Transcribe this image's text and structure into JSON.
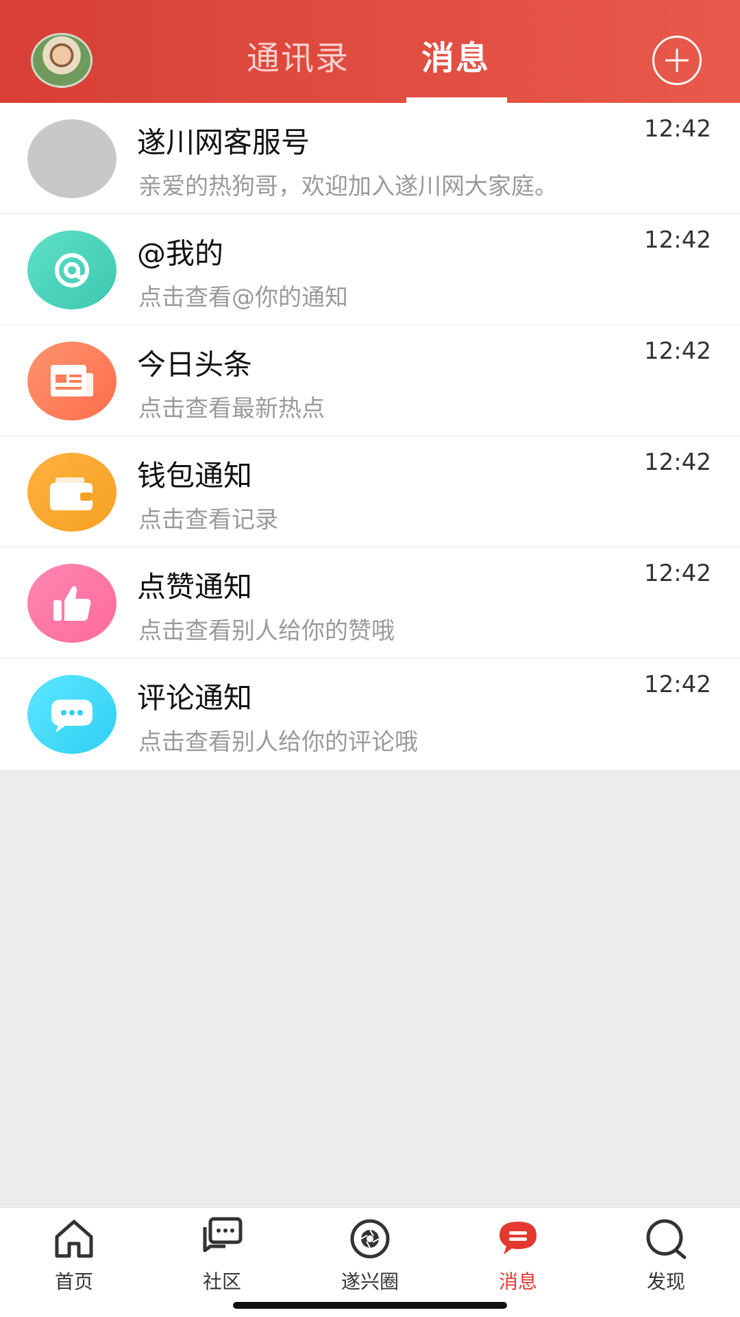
{
  "header": {
    "tabs": [
      {
        "label": "通讯录"
      },
      {
        "label": "消息",
        "active": true
      }
    ],
    "add_icon": "plus-circle-icon"
  },
  "messages": [
    {
      "title": "遂川网客服号",
      "subtitle": "亲爱的热狗哥，欢迎加入遂川网大家庭。",
      "time": "12:42",
      "icon": "gray-avatar"
    },
    {
      "title": "@我的",
      "subtitle": "点击查看@你的通知",
      "time": "12:42",
      "icon": "at-icon"
    },
    {
      "title": "今日头条",
      "subtitle": "点击查看最新热点",
      "time": "12:42",
      "icon": "newspaper-icon"
    },
    {
      "title": "钱包通知",
      "subtitle": "点击查看记录",
      "time": "12:42",
      "icon": "wallet-icon"
    },
    {
      "title": "点赞通知",
      "subtitle": "点击查看别人给你的赞哦",
      "time": "12:42",
      "icon": "thumbs-up-icon"
    },
    {
      "title": "评论通知",
      "subtitle": "点击查看别人给你的评论哦",
      "time": "12:42",
      "icon": "comment-icon"
    }
  ],
  "bottom_nav": [
    {
      "label": "首页",
      "icon": "home-icon"
    },
    {
      "label": "社区",
      "icon": "community-chat-icon"
    },
    {
      "label": "遂兴圈",
      "icon": "camera-aperture-icon"
    },
    {
      "label": "消息",
      "icon": "message-bubble-icon",
      "active": true
    },
    {
      "label": "发现",
      "icon": "discover-icon"
    }
  ],
  "colors": {
    "header_red": "#d83f36",
    "active_red": "#e4392f",
    "background": "#ececec"
  }
}
